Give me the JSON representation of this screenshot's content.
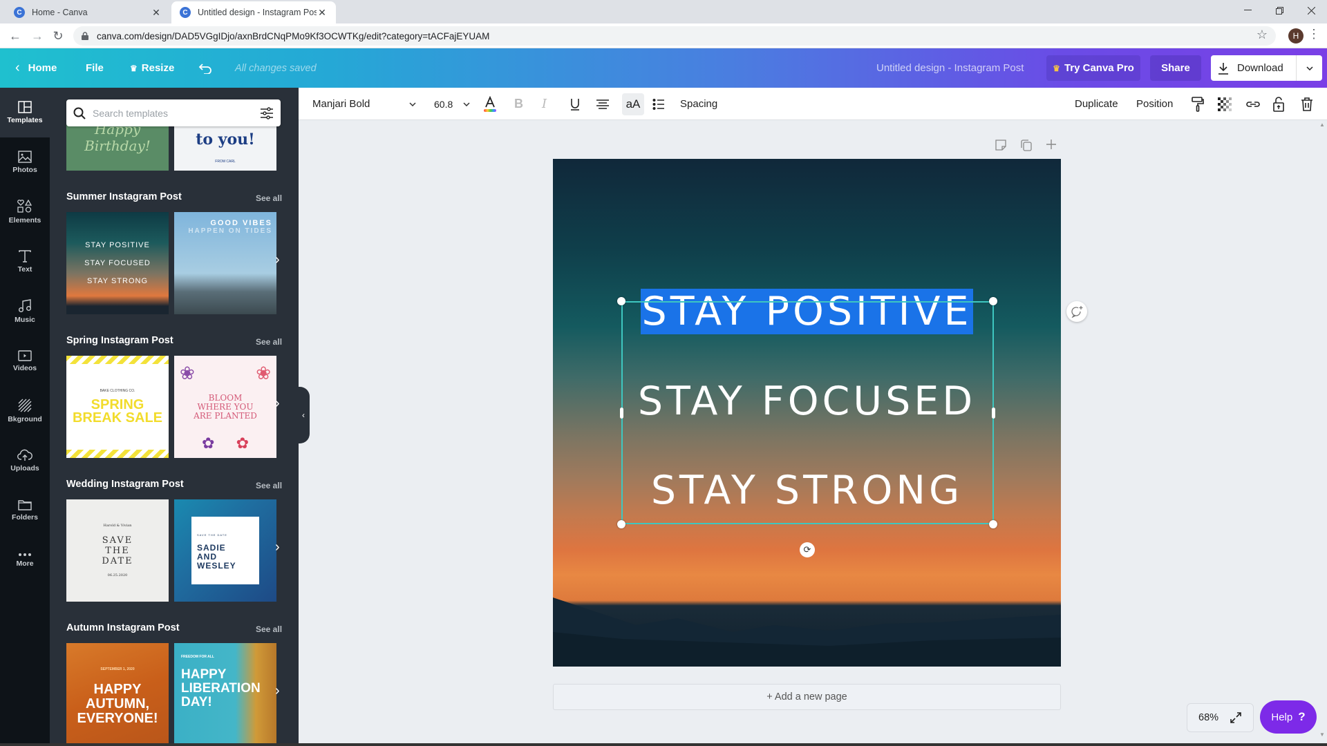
{
  "browser": {
    "tabs": [
      {
        "title": "Home - Canva",
        "favicon": "C",
        "active": false
      },
      {
        "title": "Untitled design - Instagram Post",
        "favicon": "C",
        "active": true
      }
    ],
    "url": "canva.com/design/DAD5VGgIDjo/axnBrdCNqPMo9Kf3OCWTKg/edit?category=tACFajEYUAM",
    "profile_initial": "H",
    "close_tab_glyph": "✕"
  },
  "header": {
    "home_label": "Home",
    "file_label": "File",
    "resize_label": "Resize",
    "save_status": "All changes saved",
    "design_title": "Untitled design - Instagram Post",
    "try_pro_label": "Try Canva Pro",
    "share_label": "Share",
    "download_label": "Download"
  },
  "rail": {
    "items": [
      {
        "label": "Templates",
        "icon": "templates-icon",
        "active": true
      },
      {
        "label": "Photos",
        "icon": "photos-icon"
      },
      {
        "label": "Elements",
        "icon": "elements-icon"
      },
      {
        "label": "Text",
        "icon": "text-icon"
      },
      {
        "label": "Music",
        "icon": "music-icon"
      },
      {
        "label": "Videos",
        "icon": "videos-icon"
      },
      {
        "label": "Bkground",
        "icon": "background-icon"
      },
      {
        "label": "Uploads",
        "icon": "uploads-icon"
      },
      {
        "label": "Folders",
        "icon": "folders-icon"
      },
      {
        "label": "More",
        "icon": "more-icon"
      }
    ]
  },
  "panel": {
    "search_placeholder": "Search templates",
    "see_all_label": "See all",
    "top_partial": {
      "thumb1_text": "Happy Birthday!",
      "thumb2_text": "to you!",
      "thumb2_sub": "FROM CARL"
    },
    "sections": [
      {
        "title": "Summer Instagram Post",
        "thumbs": [
          {
            "lines": [
              "STAY POSITIVE",
              "STAY FOCUSED",
              "STAY STRONG"
            ]
          },
          {
            "lines": [
              "GOOD VIBES",
              "HAPPEN ON TIDES"
            ]
          }
        ]
      },
      {
        "title": "Spring Instagram Post",
        "thumbs": [
          {
            "small": "BAKE CLOTHING CO.",
            "lines": [
              "SPRING",
              "BREAK SALE"
            ]
          },
          {
            "lines": [
              "BLOOM",
              "WHERE YOU",
              "ARE PLANTED"
            ]
          }
        ]
      },
      {
        "title": "Wedding Instagram Post",
        "thumbs": [
          {
            "small": "Harold & Vivian",
            "lines": [
              "SAVE",
              "THE",
              "DATE"
            ],
            "date": "06.25.2020"
          },
          {
            "small": "SAVE THE DATE",
            "lines": [
              "SADIE",
              "AND",
              "WESLEY"
            ]
          }
        ]
      },
      {
        "title": "Autumn Instagram Post",
        "thumbs": [
          {
            "small": "SEPTEMBER 1, 2020",
            "lines": [
              "HAPPY",
              "AUTUMN,",
              "EVERYONE!"
            ]
          },
          {
            "small": "FREEDOM FOR ALL",
            "lines": [
              "HAPPY",
              "LIBERATION",
              "DAY!"
            ]
          }
        ]
      }
    ]
  },
  "toolbar": {
    "font": "Manjari Bold",
    "font_size": "60.8",
    "case_label": "aA",
    "spacing_label": "Spacing",
    "duplicate_label": "Duplicate",
    "position_label": "Position"
  },
  "design": {
    "lines": [
      "STAY POSITIVE",
      "STAY FOCUSED",
      "STAY STRONG"
    ],
    "selected_line": "STAY POSITIVE",
    "add_page_label": "+ Add a new page"
  },
  "footer": {
    "zoom_level": "68%",
    "help_label": "Help",
    "help_glyph": "?"
  },
  "colors": {
    "brand_purple": "#7d2ae8",
    "selection_teal": "#3ec7c0",
    "text_highlight": "#1a73e8"
  }
}
